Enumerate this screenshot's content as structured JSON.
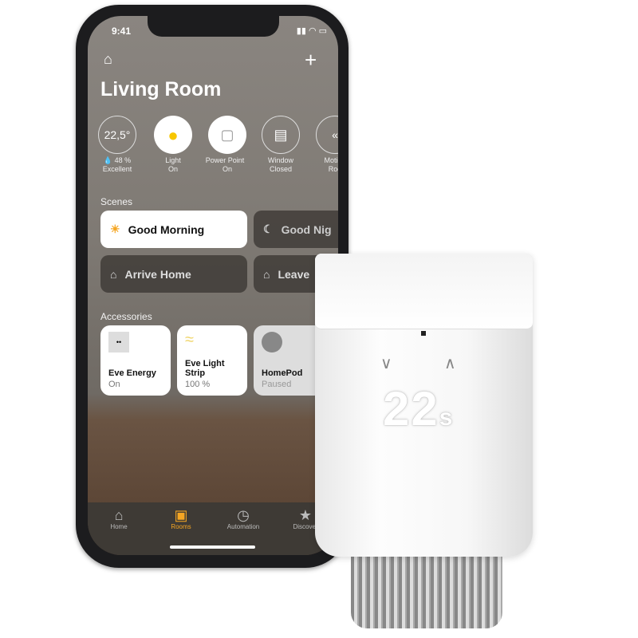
{
  "status_bar": {
    "time": "9:41"
  },
  "header": {
    "room_title": "Living Room",
    "home_icon": "house-icon",
    "add_icon": "plus-icon"
  },
  "status_items": [
    {
      "value": "22,5°",
      "line1": "48 %",
      "line2": "Excellent"
    },
    {
      "label": "Light",
      "state": "On",
      "icon": "lightbulb-icon"
    },
    {
      "label": "Power Point",
      "state": "On",
      "icon": "outlet-icon"
    },
    {
      "label": "Window",
      "state": "Closed",
      "icon": "window-icon"
    },
    {
      "label": "Motion",
      "state": "Roo",
      "icon": "motion-icon"
    }
  ],
  "scenes": {
    "title": "Scenes",
    "items": [
      {
        "label": "Good Morning",
        "active": true
      },
      {
        "label": "Good Nig",
        "active": false
      },
      {
        "label": "Arrive Home",
        "active": false
      },
      {
        "label": "Leave",
        "active": false
      }
    ]
  },
  "accessories": {
    "title": "Accessories",
    "items": [
      {
        "name": "Eve Energy",
        "state": "On"
      },
      {
        "name": "Eve Light Strip",
        "state": "100 %"
      },
      {
        "name": "HomePod",
        "state": "Paused"
      }
    ]
  },
  "tabbar": {
    "items": [
      {
        "label": "Home",
        "icon": "⌂"
      },
      {
        "label": "Rooms",
        "icon": "▣",
        "active": true
      },
      {
        "label": "Automation",
        "icon": "◷"
      },
      {
        "label": "Discover",
        "icon": "★"
      }
    ]
  },
  "thermostat": {
    "display": "22",
    "display_suffix": "s",
    "down": "∨",
    "up": "∧"
  },
  "colors": {
    "accent": "#f5a623",
    "bulb": "#f7c600"
  }
}
